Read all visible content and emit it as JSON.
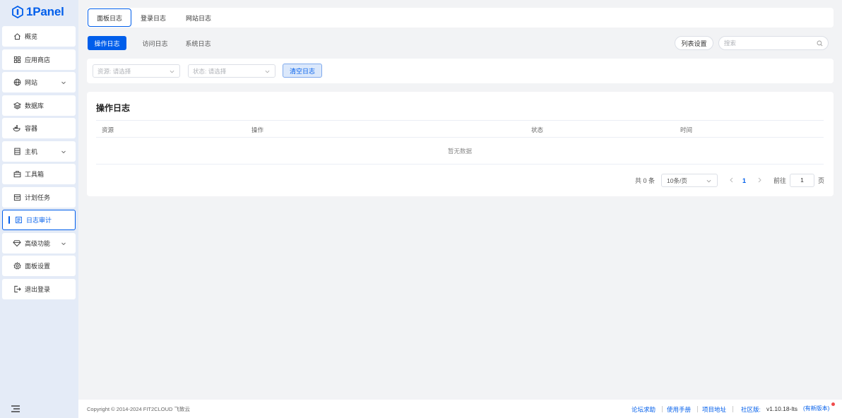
{
  "app": {
    "logo_text": "1Panel"
  },
  "sidebar": {
    "items": [
      {
        "label": "概览",
        "icon": "home-icon",
        "has_arrow": false
      },
      {
        "label": "应用商店",
        "icon": "grid-icon",
        "has_arrow": false
      },
      {
        "label": "网站",
        "icon": "globe-icon",
        "has_arrow": true
      },
      {
        "label": "数据库",
        "icon": "layers-icon",
        "has_arrow": false
      },
      {
        "label": "容器",
        "icon": "docker-icon",
        "has_arrow": false
      },
      {
        "label": "主机",
        "icon": "server-icon",
        "has_arrow": true
      },
      {
        "label": "工具箱",
        "icon": "toolbox-icon",
        "has_arrow": false
      },
      {
        "label": "计划任务",
        "icon": "calendar-icon",
        "has_arrow": false
      },
      {
        "label": "日志审计",
        "icon": "log-icon",
        "has_arrow": false,
        "active": true
      },
      {
        "label": "高级功能",
        "icon": "diamond-icon",
        "has_arrow": true
      },
      {
        "label": "面板设置",
        "icon": "gear-icon",
        "has_arrow": false
      },
      {
        "label": "退出登录",
        "icon": "logout-icon",
        "has_arrow": false
      }
    ]
  },
  "top_tabs": [
    "面板日志",
    "登录日志",
    "网站日志"
  ],
  "sub_tabs": [
    "操作日志",
    "访问日志",
    "系统日志"
  ],
  "toolbar": {
    "list_settings": "列表设置",
    "search_placeholder": "搜索"
  },
  "filters": {
    "source_placeholder": "资源: 请选择",
    "status_placeholder": "状态: 请选择",
    "clear_button": "清空日志"
  },
  "table": {
    "title": "操作日志",
    "columns": [
      "资源",
      "操作",
      "状态",
      "时间"
    ],
    "empty_text": "暂无数据"
  },
  "pagination": {
    "total_text": "共 0 条",
    "page_size": "10条/页",
    "current_page": "1",
    "goto_label": "前往",
    "goto_value": "1",
    "page_suffix": "页"
  },
  "footer": {
    "copyright": "Copyright © 2014-2024 FIT2CLOUD 飞致云",
    "links": [
      "论坛求助",
      "使用手册",
      "项目地址"
    ],
    "edition": "社区版:",
    "version": "v1.10.18-lts",
    "new_version": "(有新版本)"
  },
  "colors": {
    "accent": "#005eeb",
    "sidebar_bg": "#e4ebf7",
    "page_bg": "#f2f3f5",
    "badge": "#f04b4b"
  }
}
